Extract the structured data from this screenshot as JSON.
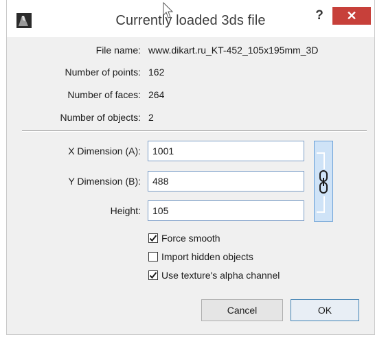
{
  "window": {
    "title": "Currently loaded 3ds file",
    "help_glyph": "?",
    "close_glyph": "✕"
  },
  "info": {
    "file_name_label": "File name:",
    "file_name_value": "www.dikart.ru_KT-452_105x195mm_3D",
    "points_label": "Number of points:",
    "points_value": "162",
    "faces_label": "Number of faces:",
    "faces_value": "264",
    "objects_label": "Number of objects:",
    "objects_value": "2"
  },
  "dimensions": {
    "x_label": "X Dimension (A):",
    "x_value": "1001",
    "y_label": "Y Dimension (B):",
    "y_value": "488",
    "height_label": "Height:",
    "height_value": "105",
    "link_icon": "chain-link-icon"
  },
  "options": [
    {
      "label": "Force smooth",
      "checked": true
    },
    {
      "label": "Import hidden objects",
      "checked": false
    },
    {
      "label": "Use texture's alpha channel",
      "checked": true
    }
  ],
  "buttons": {
    "cancel": "Cancel",
    "ok": "OK"
  },
  "colors": {
    "close_button": "#c7403a",
    "link_button": "#cfe3f7",
    "field_border": "#7a9cc6"
  }
}
